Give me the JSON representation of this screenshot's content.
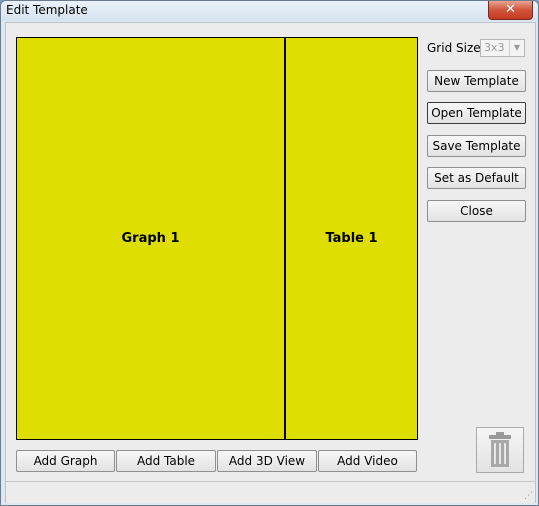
{
  "window": {
    "title": "Edit Template",
    "close_glyph": "✕"
  },
  "canvas": {
    "cells": [
      {
        "label": "Graph 1"
      },
      {
        "label": "Table 1"
      }
    ],
    "fill_color": "#dede00"
  },
  "bottom_buttons": {
    "add_graph": "Add Graph",
    "add_table": "Add Table",
    "add_3d_view": "Add 3D View",
    "add_video": "Add Video"
  },
  "side_panel": {
    "grid_size_label": "Grid Size:",
    "grid_size_value": "3x3",
    "new_template": "New Template",
    "open_template": "Open Template",
    "save_template": "Save Template",
    "set_default": "Set as Default",
    "close": "Close"
  },
  "icons": {
    "trash": "trash-icon"
  }
}
